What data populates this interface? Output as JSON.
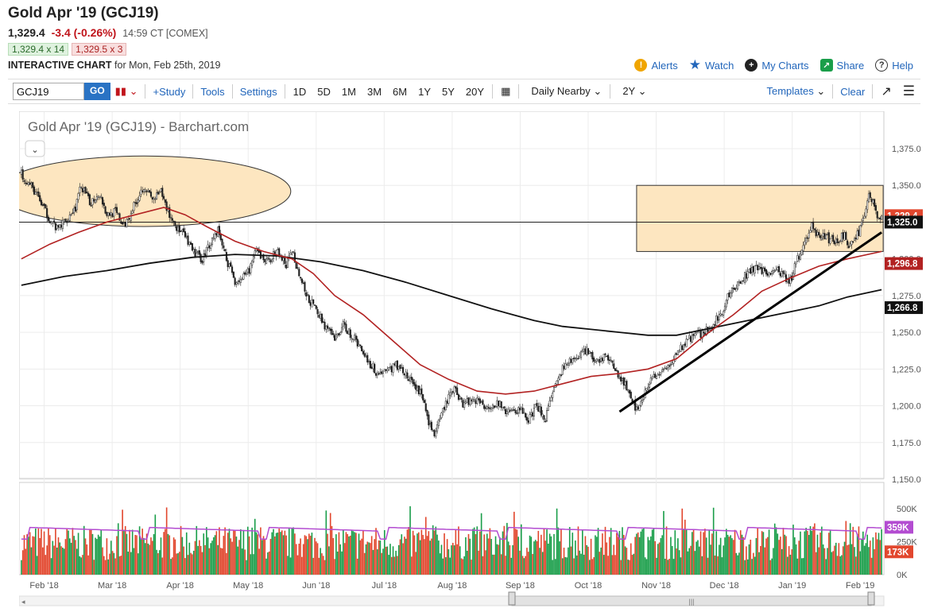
{
  "header": {
    "title": "Gold Apr '19 (GCJ19)",
    "last": "1,329.4",
    "change": "-3.4 (-0.26%)",
    "time": "14:59 CT [COMEX]",
    "bid": "1,329.4 x 14",
    "ask": "1,329.5 x 3",
    "interactive": "INTERACTIVE CHART",
    "for_date": "for Mon, Feb 25th, 2019"
  },
  "actions": {
    "alerts": "Alerts",
    "watch": "Watch",
    "my_charts": "My Charts",
    "share": "Share",
    "help": "Help"
  },
  "toolbar": {
    "symbol": "GCJ19",
    "go": "GO",
    "study": "+Study",
    "tools": "Tools",
    "settings": "Settings",
    "periods": [
      "1D",
      "5D",
      "1M",
      "3M",
      "6M",
      "1Y",
      "5Y",
      "20Y"
    ],
    "interval": "Daily Nearby",
    "range": "2Y",
    "templates": "Templates",
    "clear": "Clear"
  },
  "colors": {
    "up": "#1a9e4a",
    "down": "#e2472e",
    "ma50": "#b22222",
    "ma200": "#111111",
    "vol_ma": "#b34cd1",
    "zone": "#fde6c0"
  },
  "chart_data": {
    "type": "candlestick",
    "title": "Gold Apr '19 (GCJ19) - Barchart.com",
    "x_labels": [
      "Feb '18",
      "Mar '18",
      "Apr '18",
      "May '18",
      "Jun '18",
      "Jul '18",
      "Aug '18",
      "Sep '18",
      "Oct '18",
      "Nov '18",
      "Dec '18",
      "Jan '19",
      "Feb '19"
    ],
    "y_ticks": [
      "1,375.0",
      "1,350.0",
      "1,325.0",
      "1,300.0",
      "1,275.0",
      "1,250.0",
      "1,225.0",
      "1,200.0",
      "1,175.0",
      "1,150.0"
    ],
    "ylim": [
      1150,
      1375
    ],
    "price_path": [
      [
        0,
        1358
      ],
      [
        10,
        1345
      ],
      [
        18,
        1330
      ],
      [
        25,
        1320
      ],
      [
        30,
        1325
      ],
      [
        38,
        1335
      ],
      [
        42,
        1350
      ],
      [
        48,
        1338
      ],
      [
        55,
        1345
      ],
      [
        60,
        1330
      ],
      [
        66,
        1332
      ],
      [
        72,
        1322
      ],
      [
        80,
        1338
      ],
      [
        86,
        1350
      ],
      [
        92,
        1340
      ],
      [
        98,
        1345
      ],
      [
        104,
        1330
      ],
      [
        110,
        1320
      ],
      [
        115,
        1315
      ],
      [
        120,
        1305
      ],
      [
        127,
        1300
      ],
      [
        132,
        1310
      ],
      [
        138,
        1320
      ],
      [
        144,
        1300
      ],
      [
        150,
        1285
      ],
      [
        158,
        1288
      ],
      [
        165,
        1305
      ],
      [
        172,
        1298
      ],
      [
        180,
        1305
      ],
      [
        186,
        1295
      ],
      [
        190,
        1306
      ],
      [
        195,
        1290
      ],
      [
        200,
        1275
      ],
      [
        207,
        1265
      ],
      [
        213,
        1255
      ],
      [
        220,
        1245
      ],
      [
        226,
        1255
      ],
      [
        232,
        1248
      ],
      [
        238,
        1240
      ],
      [
        244,
        1230
      ],
      [
        250,
        1222
      ],
      [
        258,
        1225
      ],
      [
        265,
        1228
      ],
      [
        272,
        1218
      ],
      [
        278,
        1212
      ],
      [
        282,
        1205
      ],
      [
        285,
        1192
      ],
      [
        290,
        1180
      ],
      [
        294,
        1190
      ],
      [
        298,
        1202
      ],
      [
        304,
        1212
      ],
      [
        310,
        1202
      ],
      [
        318,
        1205
      ],
      [
        326,
        1200
      ],
      [
        334,
        1202
      ],
      [
        342,
        1195
      ],
      [
        350,
        1198
      ],
      [
        356,
        1190
      ],
      [
        362,
        1200
      ],
      [
        368,
        1192
      ],
      [
        374,
        1210
      ],
      [
        380,
        1225
      ],
      [
        388,
        1232
      ],
      [
        396,
        1238
      ],
      [
        404,
        1230
      ],
      [
        410,
        1235
      ],
      [
        416,
        1225
      ],
      [
        422,
        1218
      ],
      [
        428,
        1205
      ],
      [
        432,
        1198
      ],
      [
        438,
        1210
      ],
      [
        444,
        1220
      ],
      [
        450,
        1222
      ],
      [
        458,
        1232
      ],
      [
        465,
        1242
      ],
      [
        472,
        1248
      ],
      [
        480,
        1250
      ],
      [
        486,
        1256
      ],
      [
        492,
        1265
      ],
      [
        498,
        1278
      ],
      [
        505,
        1285
      ],
      [
        512,
        1292
      ],
      [
        518,
        1294
      ],
      [
        524,
        1290
      ],
      [
        530,
        1292
      ],
      [
        536,
        1288
      ],
      [
        540,
        1285
      ],
      [
        545,
        1300
      ],
      [
        550,
        1312
      ],
      [
        555,
        1322
      ],
      [
        560,
        1316
      ],
      [
        566,
        1314
      ],
      [
        572,
        1312
      ],
      [
        578,
        1316
      ],
      [
        582,
        1308
      ],
      [
        588,
        1318
      ],
      [
        592,
        1330
      ],
      [
        595,
        1345
      ],
      [
        598,
        1338
      ],
      [
        601,
        1330
      ],
      [
        604,
        1329.4
      ]
    ],
    "ma50_path": [
      [
        0,
        1300
      ],
      [
        20,
        1310
      ],
      [
        40,
        1318
      ],
      [
        60,
        1325
      ],
      [
        80,
        1330
      ],
      [
        100,
        1335
      ],
      [
        115,
        1330
      ],
      [
        130,
        1322
      ],
      [
        150,
        1312
      ],
      [
        170,
        1305
      ],
      [
        190,
        1300
      ],
      [
        205,
        1290
      ],
      [
        220,
        1275
      ],
      [
        240,
        1262
      ],
      [
        260,
        1245
      ],
      [
        280,
        1228
      ],
      [
        300,
        1218
      ],
      [
        320,
        1210
      ],
      [
        340,
        1208
      ],
      [
        360,
        1210
      ],
      [
        380,
        1215
      ],
      [
        400,
        1220
      ],
      [
        420,
        1222
      ],
      [
        440,
        1225
      ],
      [
        460,
        1232
      ],
      [
        480,
        1248
      ],
      [
        500,
        1262
      ],
      [
        520,
        1278
      ],
      [
        540,
        1287
      ],
      [
        560,
        1295
      ],
      [
        580,
        1300
      ],
      [
        604,
        1305
      ]
    ],
    "ma200_path": [
      [
        0,
        1282
      ],
      [
        30,
        1288
      ],
      [
        60,
        1292
      ],
      [
        90,
        1297
      ],
      [
        120,
        1301
      ],
      [
        150,
        1303
      ],
      [
        180,
        1302
      ],
      [
        210,
        1298
      ],
      [
        240,
        1292
      ],
      [
        270,
        1284
      ],
      [
        300,
        1275
      ],
      [
        330,
        1266
      ],
      [
        360,
        1258
      ],
      [
        380,
        1254
      ],
      [
        400,
        1252
      ],
      [
        420,
        1250
      ],
      [
        440,
        1248
      ],
      [
        460,
        1248
      ],
      [
        480,
        1252
      ],
      [
        500,
        1256
      ],
      [
        520,
        1260
      ],
      [
        540,
        1264
      ],
      [
        560,
        1268
      ],
      [
        580,
        1274
      ],
      [
        604,
        1279
      ]
    ],
    "value_labels": {
      "last": "1,329.4",
      "level_line": "1,325.0",
      "ma50": "1,296.8",
      "ma200": "1,266.8"
    },
    "level_line": 1325,
    "zone_rect": {
      "start_bar": 432,
      "end_bar": 604,
      "low": 1305,
      "high": 1350
    },
    "zone_ellipse": {
      "start_bar": 0,
      "end_bar": 178,
      "low": 1322,
      "high": 1370
    },
    "trendline": {
      "from": [
        420,
        1196
      ],
      "to": [
        604,
        1318
      ]
    },
    "volume": {
      "ylim": [
        0,
        500000
      ],
      "y_ticks": [
        "500K",
        "250K",
        "0K"
      ],
      "value_labels": {
        "ma": "359K",
        "last": "173K"
      },
      "avg": 300000
    }
  }
}
